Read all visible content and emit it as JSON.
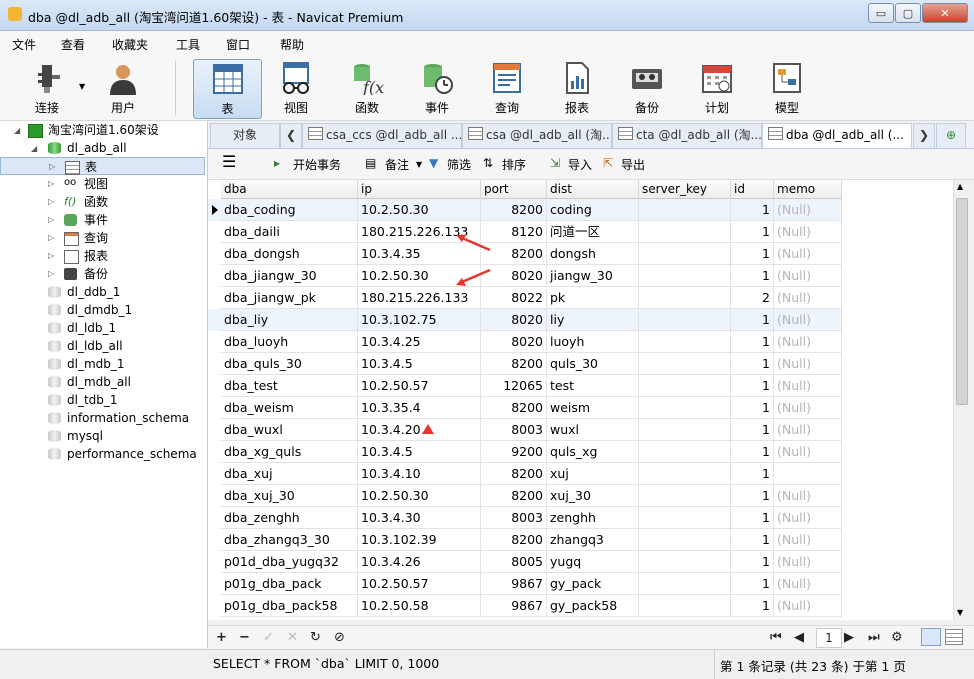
{
  "window": {
    "title": "dba @dl_adb_all (淘宝湾问道1.60架设) - 表 - Navicat Premium",
    "min_glyph": "▭",
    "max_glyph": "▢",
    "close_glyph": "✕"
  },
  "menu": [
    "文件",
    "查看",
    "收藏夹",
    "工具",
    "窗口",
    "帮助"
  ],
  "toolbar": {
    "buttons": [
      {
        "label": "连接",
        "icon": "plug-icon"
      },
      {
        "label": "用户",
        "icon": "user-icon"
      },
      {
        "label": "表",
        "icon": "table-icon",
        "active": true
      },
      {
        "label": "视图",
        "icon": "view-icon"
      },
      {
        "label": "函数",
        "icon": "function-icon"
      },
      {
        "label": "事件",
        "icon": "event-icon"
      },
      {
        "label": "查询",
        "icon": "query-icon"
      },
      {
        "label": "报表",
        "icon": "report-icon"
      },
      {
        "label": "备份",
        "icon": "backup-icon"
      },
      {
        "label": "计划",
        "icon": "schedule-icon"
      },
      {
        "label": "模型",
        "icon": "model-icon"
      }
    ]
  },
  "sidebar": {
    "connection": "淘宝湾问道1.60架设",
    "active_db": "dl_adb_all",
    "children": [
      {
        "label": "表",
        "icon": "table-icon"
      },
      {
        "label": "视图",
        "icon": "view-icon"
      },
      {
        "label": "函数",
        "icon": "function-icon"
      },
      {
        "label": "事件",
        "icon": "event-icon"
      },
      {
        "label": "查询",
        "icon": "query-icon"
      },
      {
        "label": "报表",
        "icon": "report-icon"
      },
      {
        "label": "备份",
        "icon": "backup-icon"
      }
    ],
    "databases": [
      "dl_ddb_1",
      "dl_dmdb_1",
      "dl_ldb_1",
      "dl_ldb_all",
      "dl_mdb_1",
      "dl_mdb_all",
      "dl_tdb_1",
      "information_schema",
      "mysql",
      "performance_schema"
    ]
  },
  "tabs": {
    "objects": "对象",
    "open": [
      "csa_ccs @dl_adb_all ...",
      "csa @dl_adb_all (淘...",
      "cta @dl_adb_all (淘...",
      "dba @dl_adb_all (..."
    ]
  },
  "subtoolbar": {
    "begin_tx": "开始事务",
    "note": "备注",
    "filter": "筛选",
    "sort": "排序",
    "import": "导入",
    "export": "导出"
  },
  "table": {
    "columns": [
      "dba",
      "ip",
      "port",
      "dist",
      "server_key",
      "id",
      "memo"
    ],
    "rows": [
      [
        "dba_coding",
        "10.2.50.30",
        "8200",
        "coding",
        "",
        "1",
        "(Null)"
      ],
      [
        "dba_daili",
        "180.215.226.133",
        "8120",
        "问道一区",
        "",
        "1",
        "(Null)"
      ],
      [
        "dba_dongsh",
        "10.3.4.35",
        "8200",
        "dongsh",
        "",
        "1",
        "(Null)"
      ],
      [
        "dba_jiangw_30",
        "10.2.50.30",
        "8020",
        "jiangw_30",
        "",
        "1",
        "(Null)"
      ],
      [
        "dba_jiangw_pk",
        "180.215.226.133",
        "8022",
        "pk",
        "",
        "2",
        "(Null)"
      ],
      [
        "dba_liy",
        "10.3.102.75",
        "8020",
        "liy",
        "",
        "1",
        "(Null)"
      ],
      [
        "dba_luoyh",
        "10.3.4.25",
        "8020",
        "luoyh",
        "",
        "1",
        "(Null)"
      ],
      [
        "dba_quls_30",
        "10.3.4.5",
        "8200",
        "quls_30",
        "",
        "1",
        "(Null)"
      ],
      [
        "dba_test",
        "10.2.50.57",
        "12065",
        "test",
        "",
        "1",
        "(Null)"
      ],
      [
        "dba_weism",
        "10.3.35.4",
        "8200",
        "weism",
        "",
        "1",
        "(Null)"
      ],
      [
        "dba_wuxl",
        "10.3.4.20",
        "8003",
        "wuxl",
        "",
        "1",
        "(Null)"
      ],
      [
        "dba_xg_quls",
        "10.3.4.5",
        "9200",
        "quls_xg",
        "",
        "1",
        "(Null)"
      ],
      [
        "dba_xuj",
        "10.3.4.10",
        "8200",
        "xuj",
        "",
        "1",
        ""
      ],
      [
        "dba_xuj_30",
        "10.2.50.30",
        "8200",
        "xuj_30",
        "",
        "1",
        "(Null)"
      ],
      [
        "dba_zenghh",
        "10.3.4.30",
        "8003",
        "zenghh",
        "",
        "1",
        "(Null)"
      ],
      [
        "dba_zhangq3_30",
        "10.3.102.39",
        "8200",
        "zhangq3",
        "",
        "1",
        "(Null)"
      ],
      [
        "p01d_dba_yugq32",
        "10.3.4.26",
        "8005",
        "yugq",
        "",
        "1",
        "(Null)"
      ],
      [
        "p01g_dba_pack",
        "10.2.50.57",
        "9867",
        "gy_pack",
        "",
        "1",
        "(Null)"
      ],
      [
        "p01g_dba_pack58",
        "10.2.50.58",
        "9867",
        "gy_pack58",
        "",
        "1",
        "(Null)"
      ]
    ]
  },
  "pager": {
    "page": "1"
  },
  "status": {
    "sql": "SELECT * FROM `dba` LIMIT 0, 1000",
    "record": "第 1 条记录 (共 23 条) 于第 1 页"
  },
  "colors": {
    "accent": "#3a78c4",
    "annotation_red": "#e8352a",
    "null_text": "#b5b5b5"
  }
}
